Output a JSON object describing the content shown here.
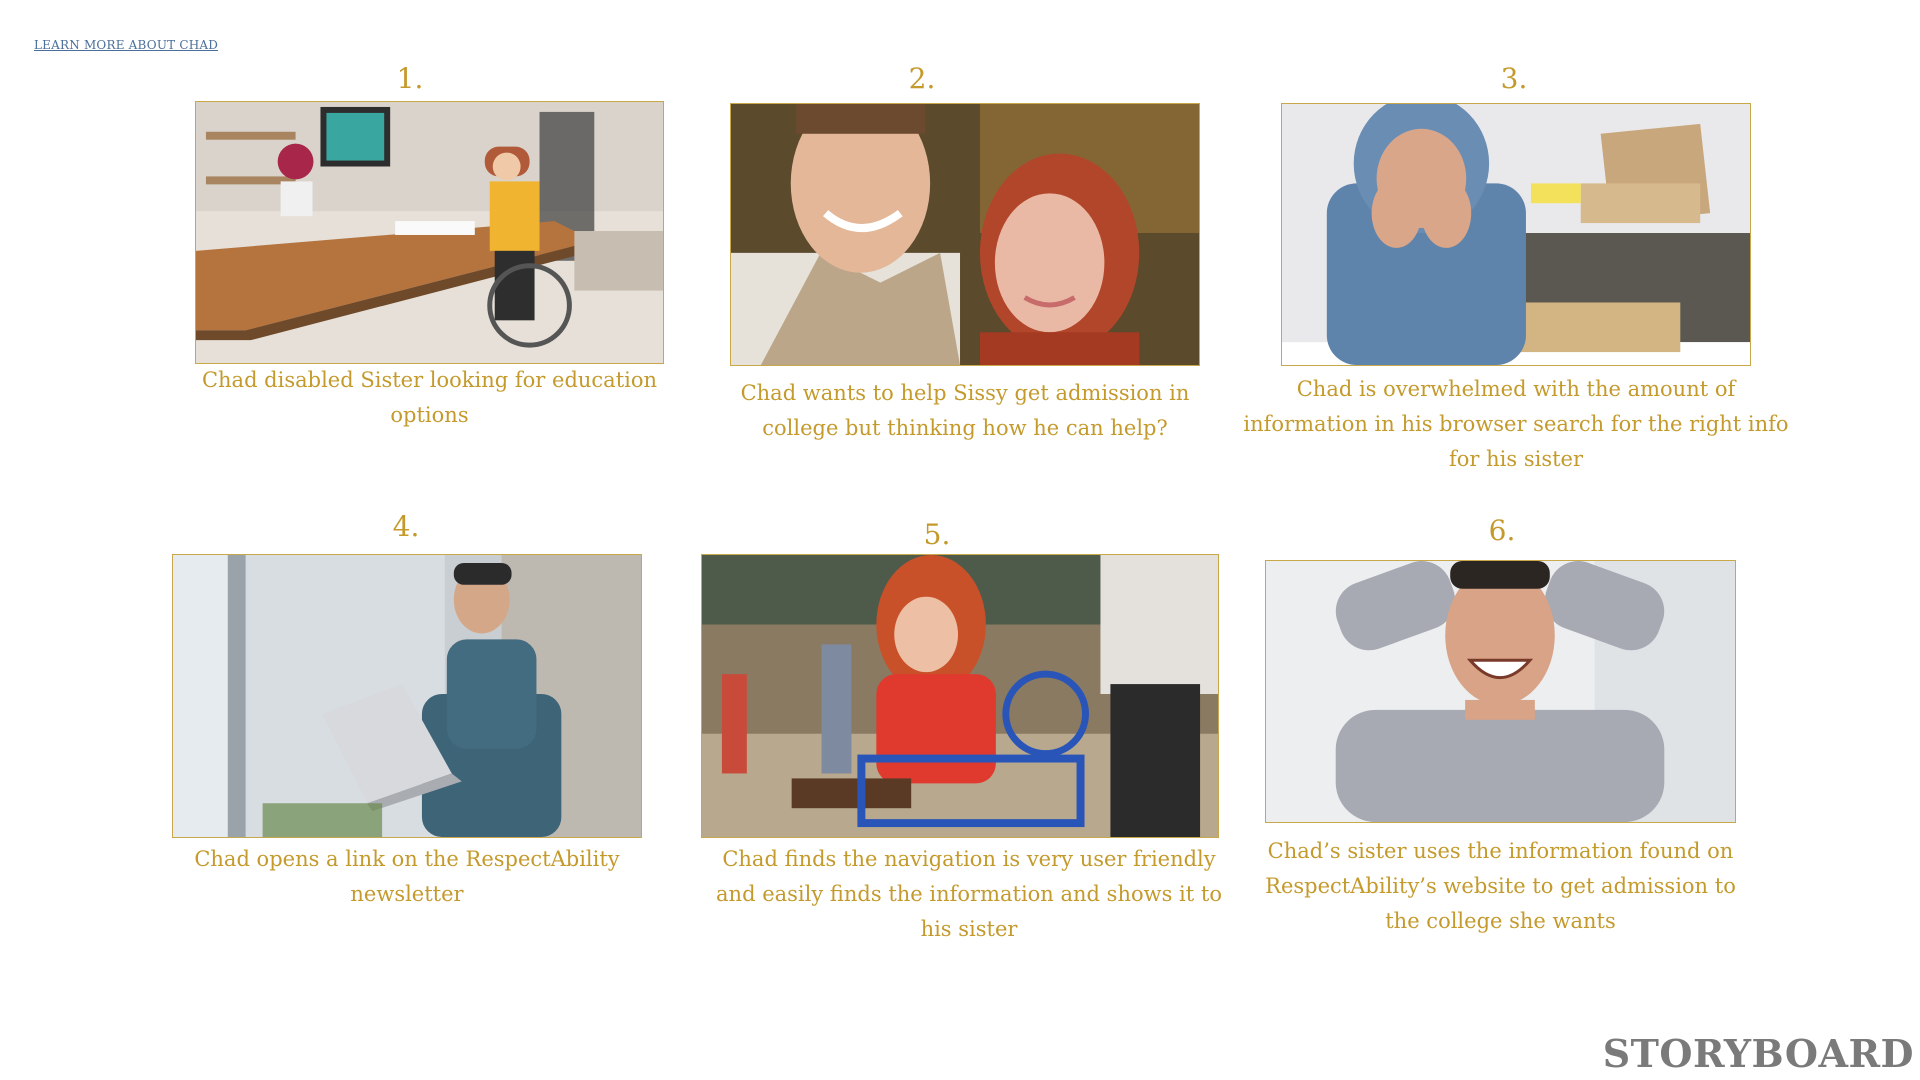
{
  "link": {
    "label": "LEARN MORE ABOUT CHAD"
  },
  "panels": [
    {
      "number": "1.",
      "caption": "Chad disabled Sister  looking for education options",
      "image": "woman-wheelchair-desk-photo"
    },
    {
      "number": "2.",
      "caption": "Chad wants to help Sissy get admission in college but thinking how he can help?",
      "image": "brother-sister-smiling-photo"
    },
    {
      "number": "3.",
      "caption": "Chad is overwhelmed with the amount of information in his browser search for the right info for his sister",
      "image": "man-hands-on-face-photo"
    },
    {
      "number": "4.",
      "caption": "Chad opens a link on the RespectAbility newsletter",
      "image": "man-holding-laptop-photo"
    },
    {
      "number": "5.",
      "caption": "Chad finds the navigation is very user friendly and easily finds the information and shows it to his sister",
      "image": "woman-wheelchair-tablet-photo"
    },
    {
      "number": "6.",
      "caption": "Chad’s sister uses the information found on RespectAbility’s website to get admission to the college she wants",
      "image": "man-happy-hands-behind-head-photo"
    }
  ],
  "watermark": {
    "label": "STORYBOARD"
  },
  "colors": {
    "accent": "#c49a2c",
    "link": "#4a6f9a",
    "frame": "#c9a84c"
  }
}
